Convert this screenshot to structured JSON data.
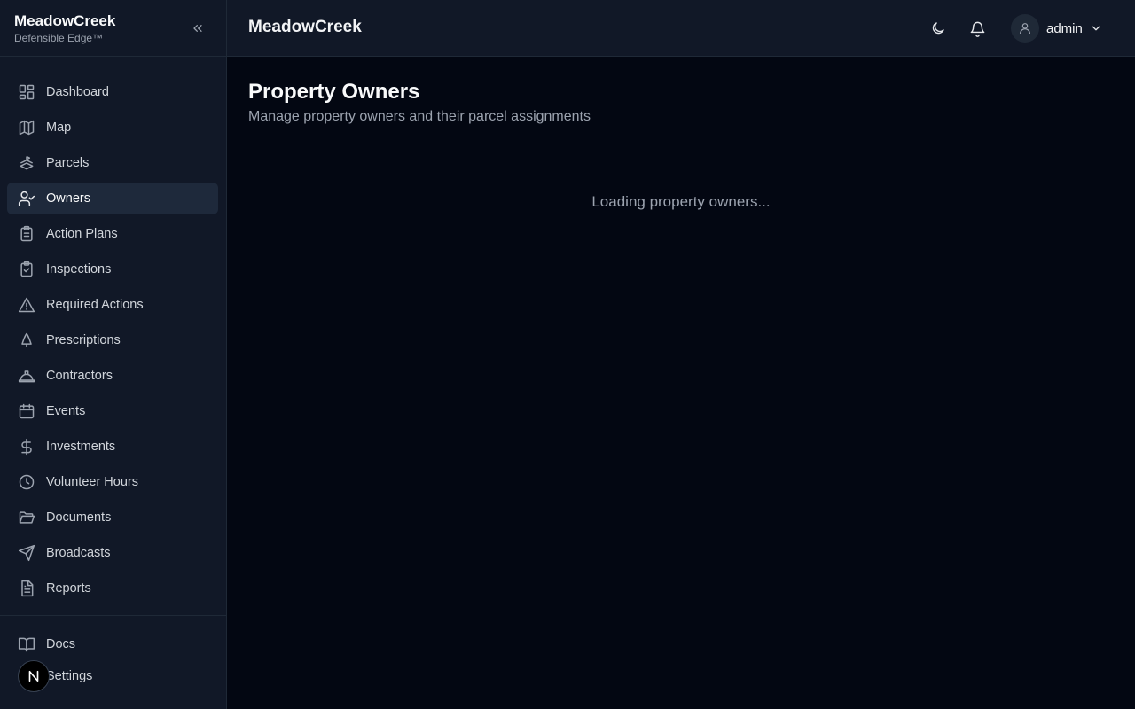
{
  "brand": {
    "name": "MeadowCreek",
    "tagline": "Defensible Edge™"
  },
  "sidebar": {
    "items": [
      {
        "label": "Dashboard",
        "icon": "dashboard-icon"
      },
      {
        "label": "Map",
        "icon": "map-icon"
      },
      {
        "label": "Parcels",
        "icon": "parcels-icon"
      },
      {
        "label": "Owners",
        "icon": "user-check-icon",
        "active": true
      },
      {
        "label": "Action Plans",
        "icon": "clipboard-list-icon"
      },
      {
        "label": "Inspections",
        "icon": "clipboard-check-icon"
      },
      {
        "label": "Required Actions",
        "icon": "warning-icon"
      },
      {
        "label": "Prescriptions",
        "icon": "tree-icon"
      },
      {
        "label": "Contractors",
        "icon": "hard-hat-icon"
      },
      {
        "label": "Events",
        "icon": "calendar-icon"
      },
      {
        "label": "Investments",
        "icon": "dollar-icon"
      },
      {
        "label": "Volunteer Hours",
        "icon": "clock-icon"
      },
      {
        "label": "Documents",
        "icon": "folder-icon"
      },
      {
        "label": "Broadcasts",
        "icon": "send-icon"
      },
      {
        "label": "Reports",
        "icon": "file-text-icon"
      }
    ],
    "bottom": [
      {
        "label": "Docs",
        "icon": "book-icon"
      },
      {
        "label": "Settings",
        "icon": "gear-icon"
      }
    ]
  },
  "header": {
    "title": "MeadowCreek",
    "user": "admin"
  },
  "main": {
    "title": "Property Owners",
    "subtitle": "Manage property owners and their parcel assignments",
    "loading": "Loading property owners..."
  },
  "fab": {
    "letter": "N"
  },
  "colors": {
    "background": "#030712",
    "sidebar": "#111827",
    "active": "#1e293b",
    "muted": "#9ca3af"
  }
}
